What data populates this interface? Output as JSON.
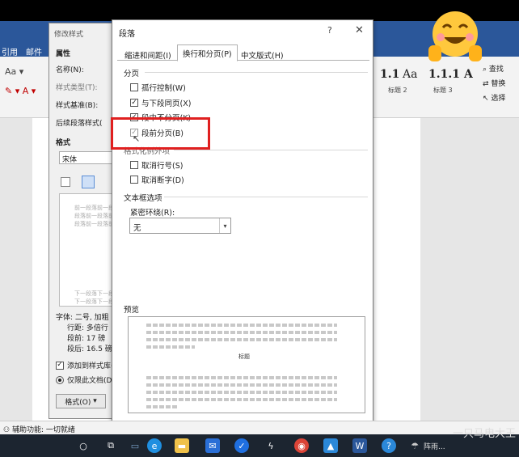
{
  "ribbon": {
    "tabs": [
      "引用",
      "邮件"
    ],
    "styles": [
      {
        "sample": "1.1",
        "label": ""
      },
      {
        "sample": "Aa",
        "label": "标题 2"
      },
      {
        "sample": "1.1.1",
        "label": "标题 3"
      },
      {
        "sample": "A",
        "label": ""
      }
    ],
    "right": [
      "查找",
      "替换",
      "选择"
    ]
  },
  "back_dialog": {
    "title": "修改样式",
    "labels": [
      "属性",
      "名称(N):",
      "样式类型(T):",
      "样式基准(B):",
      "后续段落样式(",
      "格式",
      "宋体",
      "字体: 二号, 加粗",
      "行距: 多倍行",
      "段前: 17 磅",
      "段后: 16.5 磅",
      "添加到样式库(",
      "仅限此文档(D",
      "格式(O)"
    ],
    "preview_lines": [
      "前一段落前一段",
      "段落前一段落前",
      "段落前一段落前",
      "下一段落下一段",
      "下一段落下一段"
    ]
  },
  "dialog": {
    "title": "段落",
    "help": "?",
    "close": "✕",
    "tabs": [
      "缩进和间距(I)",
      "换行和分页(P)",
      "中文版式(H)"
    ],
    "sections": {
      "pagination": "分页",
      "format_exceptions": "格式化例外项",
      "textbox": "文本框选项",
      "preview": "预览"
    },
    "checkboxes": [
      {
        "label": "孤行控制(W)",
        "checked": false
      },
      {
        "label": "与下段同页(X)",
        "checked": true
      },
      {
        "label": "段中不分页(K)",
        "checked": true
      },
      {
        "label": "段前分页(B)",
        "checked": true
      },
      {
        "label": "取消行号(S)",
        "checked": false
      },
      {
        "label": "取消断字(D)",
        "checked": false
      }
    ],
    "tight_wrap_label": "紧密环绕(R):",
    "tight_wrap_value": "无",
    "preview_center": "标题"
  },
  "status": {
    "accessibility": "辅助功能: 一切就绪"
  },
  "taskbar": {
    "watermark": "一只马电大王",
    "weather": "阵雨..."
  }
}
